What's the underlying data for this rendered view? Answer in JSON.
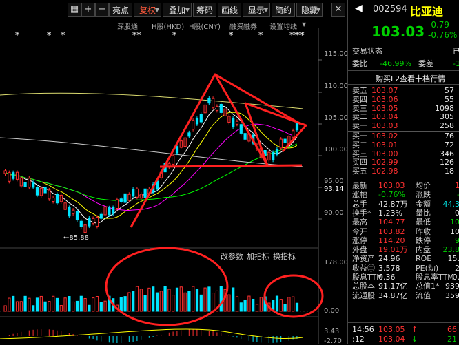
{
  "toolbar": {
    "nav_left": "◀",
    "nav_right": "▶",
    "zoom_in": "+",
    "zoom_out": "−",
    "buttons": [
      "亮点",
      "复权",
      "叠加",
      "筹码",
      "画线",
      "显示",
      "简约",
      "隐藏"
    ],
    "selected_index": 1,
    "dropdowns": [
      false,
      true,
      true,
      false,
      false,
      true,
      false,
      true
    ]
  },
  "chart": {
    "stars": [
      "*",
      "*",
      "*",
      "**",
      "*",
      "*",
      "*",
      "**",
      "**"
    ],
    "indicators": [
      "深股通",
      "H股(HKD)",
      "H股(CNY)",
      "融资融券",
      "设置均线"
    ],
    "price_ticks": [
      "115.00",
      "110.00",
      "105.00",
      "100.00",
      "95.00",
      "93.14",
      "90.00"
    ],
    "low_label": "85.88",
    "volume_menu": [
      "改参数",
      "加指标",
      "换指标"
    ],
    "volume_ticks": [
      "178.00",
      "0.00"
    ],
    "macd_ticks": [
      "3.43",
      "-2.70"
    ]
  },
  "colors": {
    "up": "#ff3030",
    "down": "#00e5ff",
    "annotation": "#ff2020",
    "ma5": "#ffffff",
    "ma10": "#ffff00",
    "ma20": "#ff00ff",
    "ma60": "#00ff00"
  },
  "quote": {
    "code": "002594",
    "name": "比亚迪",
    "price": "103.03",
    "change": "-0.79",
    "change_pct": "-0.76%",
    "status_label": "交易状态",
    "status_value": "已",
    "weibi_label": "委比",
    "weibi_value": "-46.99%",
    "weicha_label": "委差",
    "weicha_value": "-1",
    "l2_link": "购买L2查看十档行情",
    "asks": [
      {
        "label": "卖五",
        "price": "103.07",
        "vol": "57"
      },
      {
        "label": "卖四",
        "price": "103.06",
        "vol": "55"
      },
      {
        "label": "卖三",
        "price": "103.05",
        "vol": "1098"
      },
      {
        "label": "卖二",
        "price": "103.04",
        "vol": "305"
      },
      {
        "label": "卖一",
        "price": "103.03",
        "vol": "258"
      }
    ],
    "bids": [
      {
        "label": "买一",
        "price": "103.02",
        "vol": "76"
      },
      {
        "label": "买二",
        "price": "103.01",
        "vol": "72"
      },
      {
        "label": "买三",
        "price": "103.00",
        "vol": "346"
      },
      {
        "label": "买四",
        "price": "102.99",
        "vol": "126"
      },
      {
        "label": "买五",
        "price": "102.98",
        "vol": "18"
      }
    ],
    "stats": [
      {
        "l1": "最新",
        "v1": "103.03",
        "c1": "red",
        "l2": "均价",
        "v2": "1",
        "c2": "red"
      },
      {
        "l1": "涨幅",
        "v1": "-0.76%",
        "c1": "grn",
        "l2": "涨跌",
        "v2": "-",
        "c2": "grn"
      },
      {
        "l1": "总手",
        "v1": "42.87万",
        "c1": "wht",
        "l2": "金额",
        "v2": "44.3",
        "c2": "cyn"
      },
      {
        "l1": "换手*",
        "v1": "1.23%",
        "c1": "wht",
        "l2": "量比",
        "v2": "0",
        "c2": "wht"
      },
      {
        "l1": "最高",
        "v1": "104.77",
        "c1": "red",
        "l2": "最低",
        "v2": "10",
        "c2": "grn"
      },
      {
        "l1": "今开",
        "v1": "103.82",
        "c1": "red",
        "l2": "昨收",
        "v2": "10",
        "c2": "wht"
      },
      {
        "l1": "涨停",
        "v1": "114.20",
        "c1": "red",
        "l2": "跌停",
        "v2": "9",
        "c2": "grn"
      },
      {
        "l1": "外盘",
        "v1": "19.01万",
        "c1": "red",
        "l2": "内盘",
        "v2": "23.8",
        "c2": "grn"
      },
      {
        "l1": "净资产",
        "v1": "24.96",
        "c1": "wht",
        "l2": "ROE",
        "v2": "15.",
        "c2": "wht"
      },
      {
        "l1": "收益㊁",
        "v1": "3.578",
        "c1": "wht",
        "l2": "PE(动)",
        "v2": "2",
        "c2": "wht"
      },
      {
        "l1": "股息TTM",
        "v1": "0.36",
        "c1": "wht",
        "l2": "股息率TTM",
        "v2": "0.",
        "c2": "wht"
      },
      {
        "l1": "总股本",
        "v1": "91.17亿",
        "c1": "wht",
        "l2": "总值1*",
        "v2": "939",
        "c2": "wht"
      },
      {
        "l1": "流通股",
        "v1": "34.87亿",
        "c1": "wht",
        "l2": "流值",
        "v2": "359",
        "c2": "wht"
      }
    ],
    "ticks": [
      {
        "time": "14:56",
        "price": "103.05",
        "arrow": "↑",
        "vol": "66"
      },
      {
        "time": ":12",
        "price": "103.04",
        "arrow": "↓",
        "vol": "21"
      }
    ]
  }
}
